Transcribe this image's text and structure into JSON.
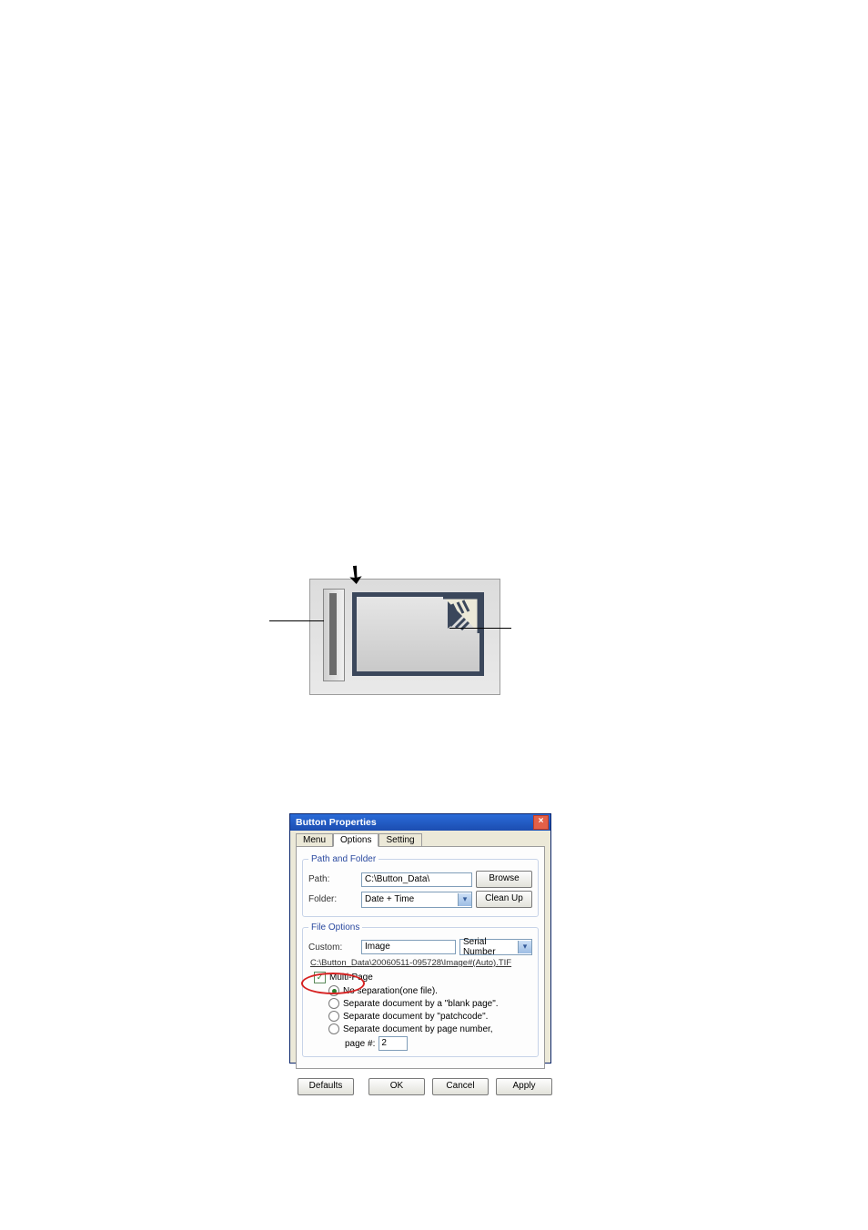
{
  "diagram": {
    "label": "scanner-icon"
  },
  "dialog": {
    "title": "Button Properties",
    "tabs": [
      "Menu",
      "Options",
      "Setting"
    ],
    "active_tab": 1,
    "path_folder": {
      "legend": "Path and Folder",
      "path_label": "Path:",
      "path_value": "C:\\Button_Data\\",
      "browse": "Browse",
      "folder_label": "Folder:",
      "folder_value": "Date + Time",
      "cleanup": "Clean Up"
    },
    "file_options": {
      "legend": "File Options",
      "custom_label": "Custom:",
      "custom_value": "Image",
      "right_combo": "Serial Number",
      "preview": "C:\\Button_Data\\20060511-095728\\Image#(Auto).TIF",
      "multipage_label": "Multi-Page",
      "multipage_checked": true,
      "radios": [
        {
          "label": "No separation(one file).",
          "selected": true
        },
        {
          "label": "Separate document by a \"blank page\".",
          "selected": false
        },
        {
          "label": "Separate document by \"patchcode\".",
          "selected": false
        },
        {
          "label": "Separate document by page number,",
          "selected": false
        }
      ],
      "page_label": "page #:",
      "page_value": "2"
    },
    "footer": {
      "defaults": "Defaults",
      "ok": "OK",
      "cancel": "Cancel",
      "apply": "Apply"
    }
  }
}
